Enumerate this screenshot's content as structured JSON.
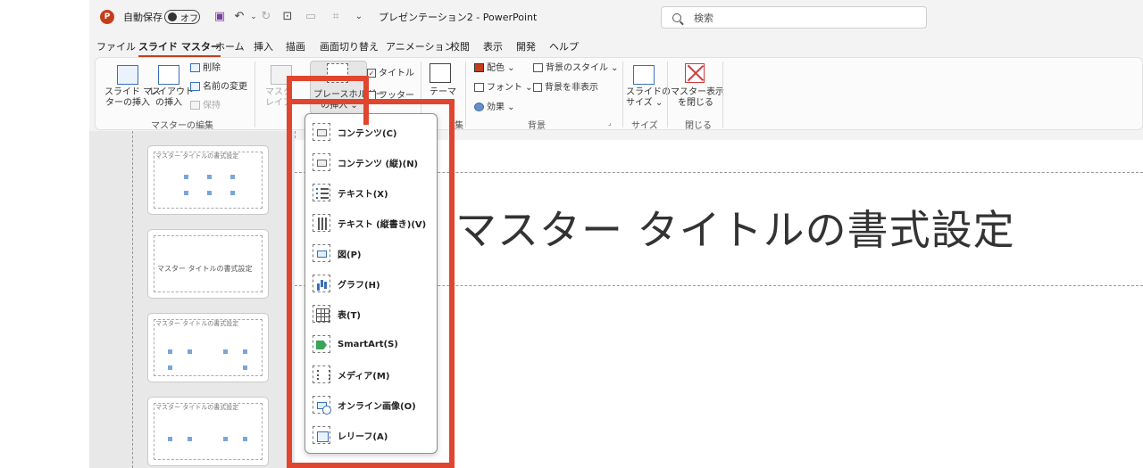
{
  "titlebar": {
    "app_icon": "powerpoint-logo",
    "autosave_label": "自動保存",
    "autosave_state": "オフ",
    "doc_title": "プレゼンテーション2 - PowerPoint",
    "search_placeholder": "検索"
  },
  "tabs": [
    {
      "label": "ファイル"
    },
    {
      "label": "スライド マスター"
    },
    {
      "label": "ホーム"
    },
    {
      "label": "挿入"
    },
    {
      "label": "描画"
    },
    {
      "label": "画面切り替え"
    },
    {
      "label": "アニメーション"
    },
    {
      "label": "校閲"
    },
    {
      "label": "表示"
    },
    {
      "label": "開発"
    },
    {
      "label": "ヘルプ"
    }
  ],
  "ribbon": {
    "insert_master_1": "スライド マス",
    "insert_master_2": "ターの挿入",
    "insert_layout_1": "レイアウト",
    "insert_layout_2": "の挿入",
    "delete": "削除",
    "rename": "名前の変更",
    "preserve": "保持",
    "group_master_edit": "マスターの編集",
    "master_layout_1": "マスタ",
    "master_layout_2": "レイア",
    "insert_placeholder_1": "プレースホルダー",
    "insert_placeholder_2": "の挿入 ⌄",
    "title_check": "タイトル",
    "footer_check": "フッター",
    "theme": "テーマ",
    "group_edit_suffix": "集",
    "colors": "配色 ⌄",
    "fonts": "フォント ⌄",
    "effects": "効果 ⌄",
    "bg_styles": "背景のスタイル ⌄",
    "hide_bg": "背景を非表示",
    "group_background": "背景",
    "slide_size_1": "スライドの",
    "slide_size_2": "サイズ ⌄",
    "group_size": "サイズ",
    "close_master_1": "マスター表示",
    "close_master_2": "を閉じる",
    "group_close": "閉じる"
  },
  "thumbs": {
    "title_text": "マスター タイトルの書式設定"
  },
  "slide": {
    "title": "マスター タイトルの書式設定"
  },
  "dropdown": {
    "items": [
      {
        "label": "コンテンツ(C)",
        "icon": "content-icon"
      },
      {
        "label": "コンテンツ (縦)(N)",
        "icon": "content-vertical-icon"
      },
      {
        "label": "テキスト(X)",
        "icon": "text-icon"
      },
      {
        "label": "テキスト (縦書き)(V)",
        "icon": "text-vertical-icon"
      },
      {
        "label": "図(P)",
        "icon": "picture-icon"
      },
      {
        "label": "グラフ(H)",
        "icon": "chart-icon"
      },
      {
        "label": "表(T)",
        "icon": "table-icon"
      },
      {
        "label": "SmartArt(S)",
        "icon": "smartart-icon"
      },
      {
        "label": "メディア(M)",
        "icon": "media-icon"
      },
      {
        "label": "オンライン画像(O)",
        "icon": "online-picture-icon"
      },
      {
        "label": "レリーフ(A)",
        "icon": "relief-icon"
      }
    ]
  },
  "colors": {
    "accent": "#c43e1c",
    "annotation_red": "#e0452f"
  }
}
